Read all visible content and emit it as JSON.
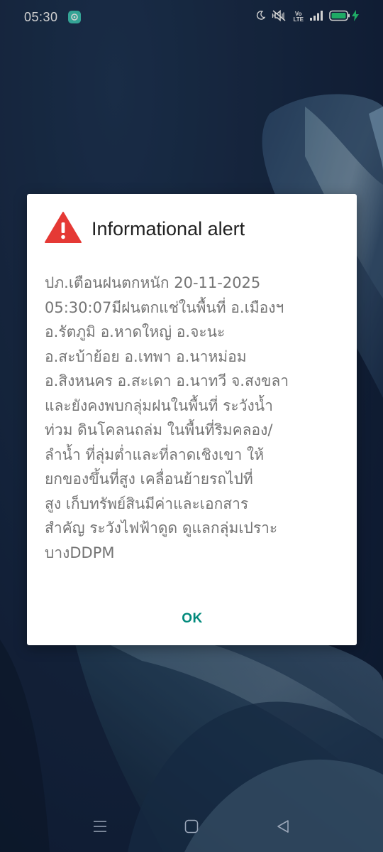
{
  "status_bar": {
    "time": "05:30",
    "volte_line1": "Vo",
    "volte_line2": "LTE"
  },
  "dialog": {
    "title": "Informational alert",
    "body": "ปภ.เตือนฝนตกหนัก  20-11-2025\n05:30:07มีฝนตกแช่ในพื้นที่ อ.เมืองฯ\nอ.รัตภูมิ อ.หาดใหญ่ อ.จะนะ\nอ.สะบ้าย้อย อ.เทพา อ.นาหม่อม\nอ.สิงหนคร อ.สะเดา อ.นาทวี จ.สงขลา\nและยังคงพบกลุ่มฝนในพื้นที่ ระวังน้ำ\nท่วม ดินโคลนถล่ม ในพื้นที่ริมคลอง/\nลำน้ำ ที่ลุ่มต่ำและที่ลาดเชิงเขา ให้\nยกของขึ้นที่สูง เคลื่อนย้ายรถไปที่\nสูง เก็บทรัพย์สินมีค่าและเอกสาร\nสำคัญ ระวังไฟฟ้าดูด ดูแลกลุ่มเปราะ\nบางDDPM",
    "ok_label": "OK",
    "accent_color": "#00897b",
    "warning_color": "#e53935"
  },
  "icons": {
    "status": [
      "chat-notification-icon",
      "moon-icon",
      "vibrate-muted-icon",
      "volte-icon",
      "signal-icon",
      "battery-icon",
      "charging-icon"
    ],
    "dialog": [
      "warning-icon"
    ],
    "nav": [
      "recents-icon",
      "home-icon",
      "back-icon"
    ]
  }
}
